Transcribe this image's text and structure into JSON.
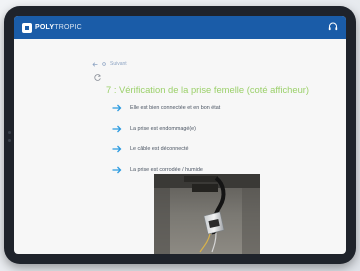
{
  "app": {
    "brand_main": "POLY",
    "brand_light": "TROPIC"
  },
  "nav": {
    "back_label": "Suivant"
  },
  "step": {
    "title": "7 : Vérification de la prise femelle (coté afficheur)",
    "options": [
      "Elle est bien connectée et en bon état",
      "La prise est endommagé(e)",
      "Le câble est déconnecté",
      "La prise est corrodée / humide"
    ]
  },
  "colors": {
    "topbar": "#1a5ca8",
    "title": "#9bd06a",
    "arrow": "#2c9be0"
  },
  "icons": {
    "help": "headset-icon",
    "back": "arrow-left-icon",
    "refresh": "refresh-icon",
    "option": "arrow-right-icon"
  }
}
